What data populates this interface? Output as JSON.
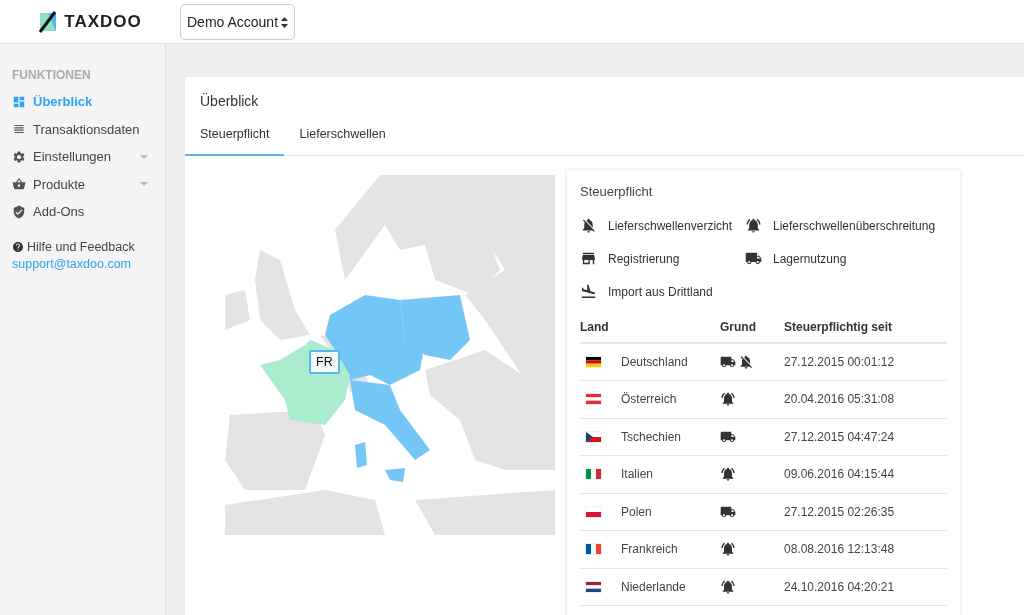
{
  "header": {
    "brand": "TAXDOO",
    "account_select": "Demo Account"
  },
  "sidebar": {
    "section": "FUNKTIONEN",
    "items": [
      {
        "label": "Überblick",
        "kind": "dashboard",
        "selected": true,
        "has_submenu": false
      },
      {
        "label": "Transaktionsdaten",
        "kind": "list",
        "selected": false,
        "has_submenu": false
      },
      {
        "label": "Einstellungen",
        "kind": "settings",
        "selected": false,
        "has_submenu": true
      },
      {
        "label": "Produkte",
        "kind": "products",
        "selected": false,
        "has_submenu": true
      },
      {
        "label": "Add-Ons",
        "kind": "shield",
        "selected": false,
        "has_submenu": false
      }
    ],
    "help": "Hilfe und Feedback",
    "email": "support@taxdoo.com"
  },
  "page": {
    "title": "Überblick",
    "tabs": [
      {
        "label": "Steuerpflicht",
        "selected": true
      },
      {
        "label": "Lieferschwellen",
        "selected": false
      }
    ]
  },
  "map": {
    "tooltip": "FR"
  },
  "legend": {
    "title": "Steuerpflicht",
    "items": [
      {
        "kind": "bell-off",
        "label": "Lieferschwellenverzicht"
      },
      {
        "kind": "bell-ring",
        "label": "Lieferschwellenüberschreitung"
      },
      {
        "kind": "store",
        "label": "Registrierung"
      },
      {
        "kind": "truck",
        "label": "Lagernutzung"
      },
      {
        "kind": "plane",
        "label": "Import aus Drittland"
      }
    ]
  },
  "table": {
    "columns": [
      "Land",
      "Grund",
      "Steuerpflichtig seit"
    ],
    "rows": [
      {
        "flag": {
          "kind": "horizontal",
          "stripes": [
            {
              "color": "#000000"
            },
            {
              "color": "#dd0000"
            },
            {
              "color": "#ffce00"
            }
          ]
        },
        "country": "Deutschland",
        "reasons": [
          {
            "kind": "truck"
          },
          {
            "kind": "bell-off"
          }
        ],
        "since": "27.12.2015 00:01:12"
      },
      {
        "flag": {
          "kind": "horizontal",
          "stripes": [
            {
              "color": "#ed2939"
            },
            {
              "color": "#ffffff"
            },
            {
              "color": "#ed2939"
            }
          ]
        },
        "country": "Österreich",
        "reasons": [
          {
            "kind": "bell-ring"
          }
        ],
        "since": "20.04.2016 05:31:08"
      },
      {
        "flag": {
          "kind": "wedge",
          "stripes": [
            {
              "color": "#ffffff"
            },
            {
              "color": "#d7141a"
            },
            {
              "color": "#11457e"
            }
          ]
        },
        "country": "Tschechien",
        "reasons": [
          {
            "kind": "truck"
          }
        ],
        "since": "27.12.2015 04:47:24"
      },
      {
        "flag": {
          "kind": "vertical",
          "stripes": [
            {
              "color": "#009246"
            },
            {
              "color": "#ffffff"
            },
            {
              "color": "#ce2b37"
            }
          ]
        },
        "country": "Italien",
        "reasons": [
          {
            "kind": "bell-ring"
          }
        ],
        "since": "09.06.2016 04:15:44"
      },
      {
        "flag": {
          "kind": "horizontal",
          "stripes": [
            {
              "color": "#ffffff"
            },
            {
              "color": "#dc143c"
            }
          ]
        },
        "country": "Polen",
        "reasons": [
          {
            "kind": "truck"
          }
        ],
        "since": "27.12.2015 02:26:35"
      },
      {
        "flag": {
          "kind": "vertical",
          "stripes": [
            {
              "color": "#0055a4"
            },
            {
              "color": "#ffffff"
            },
            {
              "color": "#ef4135"
            }
          ]
        },
        "country": "Frankreich",
        "reasons": [
          {
            "kind": "bell-ring"
          }
        ],
        "since": "08.08.2016 12:13:48"
      },
      {
        "flag": {
          "kind": "horizontal",
          "stripes": [
            {
              "color": "#ae1c28"
            },
            {
              "color": "#ffffff"
            },
            {
              "color": "#21468b"
            }
          ]
        },
        "country": "Niederlande",
        "reasons": [
          {
            "kind": "bell-ring"
          }
        ],
        "since": "24.10.2016 04:20:21"
      }
    ]
  }
}
